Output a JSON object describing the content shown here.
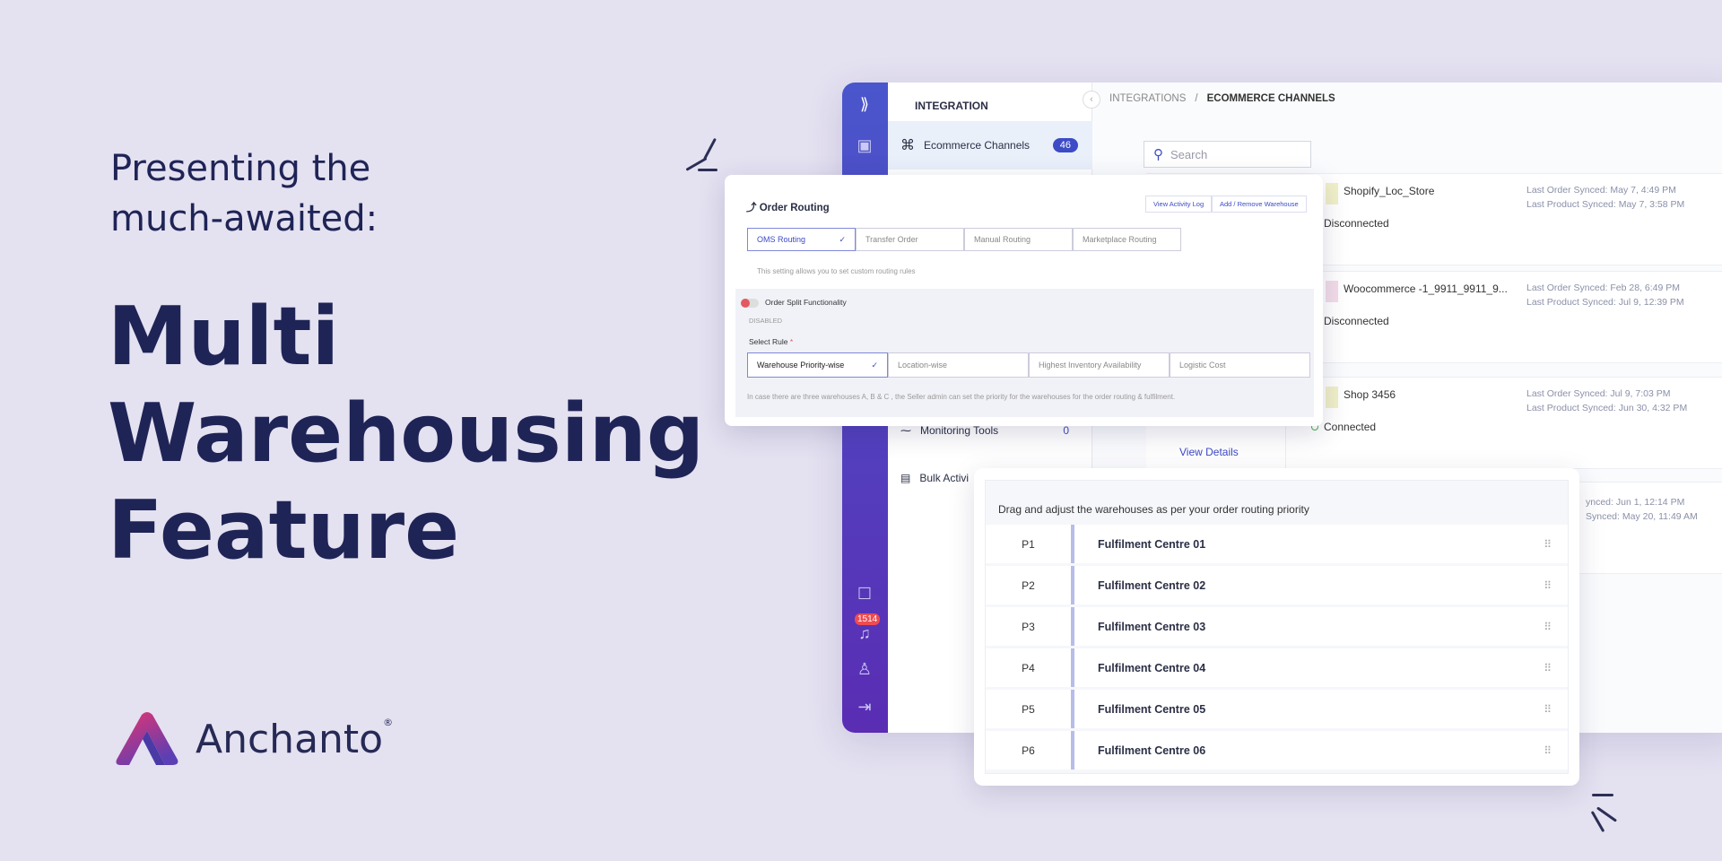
{
  "promo": {
    "intro_line1": "Presenting the",
    "intro_line2": "much-awaited:",
    "headline_line1": "Multi",
    "headline_line2": "Warehousing",
    "headline_line3": "Feature",
    "brand": "Anchanto",
    "brand_mark": "®"
  },
  "colors": {
    "background": "#e4e1f1",
    "headline": "#1f2456",
    "accent": "#3d4bc6",
    "rail_gradient": [
      "#4a56cc",
      "#5a2db3"
    ],
    "logo_gradient": [
      "#e8336f",
      "#5b3fb4"
    ]
  },
  "app": {
    "rail": {
      "icons": [
        "app-logo-icon",
        "layout-icon",
        "chat-icon",
        "bell-icon",
        "user-icon",
        "logout-icon"
      ],
      "notification_count": "1514"
    },
    "nav": {
      "section": "INTEGRATION",
      "items": [
        {
          "label": "Ecommerce Channels",
          "badge": "46",
          "icon": "command-icon"
        },
        {
          "label": "Monitoring Tools",
          "count": "0",
          "icon": "activity-icon"
        },
        {
          "label": "Bulk Activi",
          "icon": "bulk-icon"
        }
      ]
    },
    "breadcrumb": [
      "INTEGRATIONS",
      "/",
      "ECOMMERCE CHANNELS"
    ],
    "search_placeholder": "Search",
    "channels": [
      {
        "initial": "S",
        "name": "Shopify_Loc_Store",
        "status": "Disconnected",
        "last_order": "Last Order Synced: May 7, 4:49 PM",
        "last_product": "Last Product Synced: May 7, 3:58 PM"
      },
      {
        "initial": "U",
        "name": "Woocommerce -1_9911_9911_9...",
        "status": "Disconnected",
        "last_order": "Last Order Synced: Feb 28, 6:49 PM",
        "last_product": "Last Product Synced: Jul 9, 12:39 PM"
      },
      {
        "initial": "M",
        "name": "Shop 3456",
        "status": "Connected",
        "last_order": "Last Order Synced: Jul 9, 7:03 PM",
        "last_product": "Last Product Synced: Jun 30, 4:32 PM",
        "link": "View Details"
      },
      {
        "last_order": "ynced: Jun 1, 12:14 PM",
        "last_product": "Synced: May 20, 11:49 AM"
      }
    ]
  },
  "order_routing": {
    "title": "Order Routing",
    "view_log": "View Activity Log",
    "add_remove": "Add / Remove Warehouse",
    "tabs": [
      "OMS Routing",
      "Transfer Order",
      "Manual Routing",
      "Marketplace Routing"
    ],
    "selected_tab": "OMS Routing",
    "help": "This setting allows you to set custom routing rules",
    "split_label": "Order Split Functionality",
    "split_state": "DISABLED",
    "split_enabled": false,
    "rule_label": "Select Rule",
    "required": "*",
    "rules": [
      "Warehouse Priority-wise",
      "Location-wise",
      "Highest Inventory Availability",
      "Logistic Cost"
    ],
    "selected_rule": "Warehouse Priority-wise",
    "description": "In case there are three warehouses A, B & C , the Seller admin can set the priority for the warehouses for the order routing & fulfilment."
  },
  "priority": {
    "header": "Drag and adjust the warehouses as per your order routing priority",
    "rows": [
      {
        "p": "P1",
        "name": "Fulfilment Centre 01"
      },
      {
        "p": "P2",
        "name": "Fulfilment Centre 02"
      },
      {
        "p": "P3",
        "name": "Fulfilment Centre 03"
      },
      {
        "p": "P4",
        "name": "Fulfilment Centre 04"
      },
      {
        "p": "P5",
        "name": "Fulfilment Centre 05"
      },
      {
        "p": "P6",
        "name": "Fulfilment Centre 06"
      }
    ]
  }
}
